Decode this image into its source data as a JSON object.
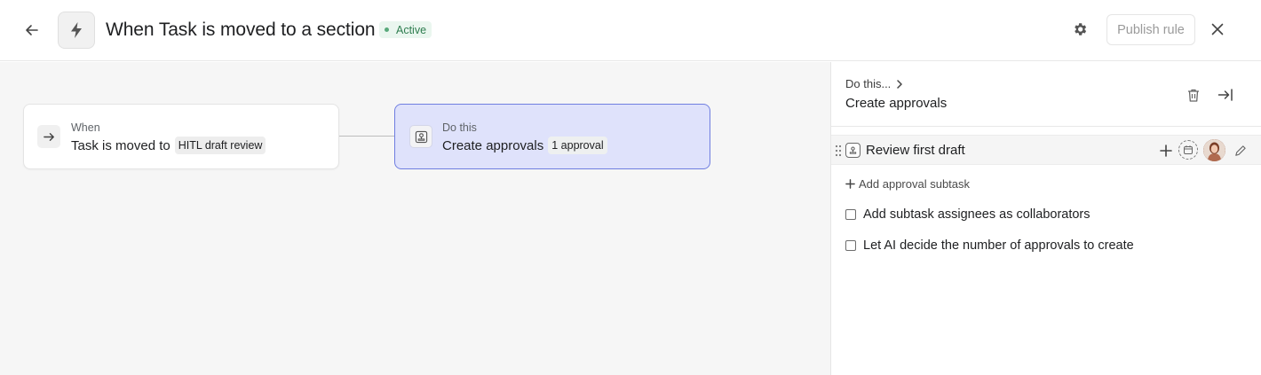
{
  "header": {
    "title": "When Task is moved to a section",
    "status": "Active",
    "publish_label": "Publish rule",
    "back_icon": "arrow-left-icon",
    "rule_icon": "lightning-icon",
    "settings_icon": "gear-icon",
    "close_icon": "close-icon"
  },
  "canvas": {
    "trigger": {
      "kicker": "When",
      "text": "Task is moved to",
      "tag": "HITL draft review",
      "icon": "arrow-right-icon"
    },
    "action": {
      "kicker": "Do this",
      "text": "Create approvals",
      "tag": "1 approval",
      "icon": "approval-stamp-icon"
    }
  },
  "panel": {
    "breadcrumb": "Do this...",
    "title": "Create approvals",
    "subtasks": [
      {
        "label": "Review first draft"
      }
    ],
    "add_subtask_label": "Add approval subtask",
    "options": [
      {
        "label": "Add subtask assignees as collaborators",
        "checked": false
      },
      {
        "label": "Let AI decide the number of approvals to create",
        "checked": false
      }
    ]
  },
  "colors": {
    "accent_border": "#6f7ee0",
    "accent_fill": "#dfe2fb",
    "status_green": "#2e7d4f"
  }
}
